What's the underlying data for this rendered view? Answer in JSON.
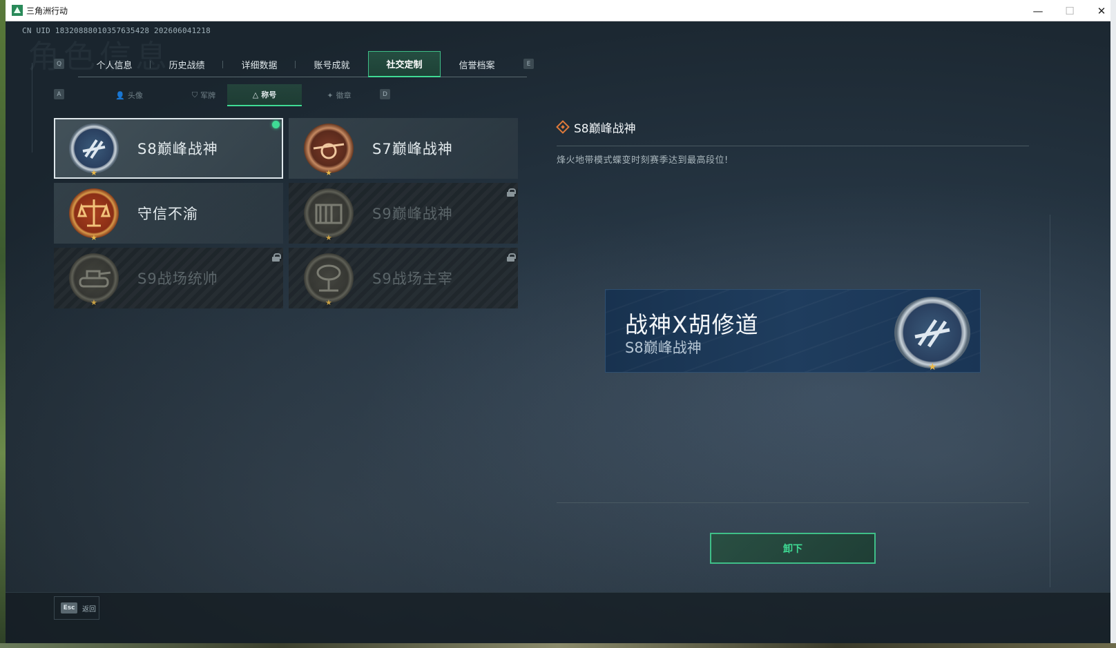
{
  "window": {
    "title": "三角洲行动",
    "minimize": "—",
    "maximize": "☐",
    "close": "✕"
  },
  "uid": "CN UID 18320888010357635428 202606041218",
  "ghost_title": "角色信息",
  "keyhints": {
    "prev_tab": "Q",
    "next_tab": "E",
    "prev_sub": "A",
    "next_sub": "D"
  },
  "top_tabs": [
    {
      "label": "个人信息"
    },
    {
      "label": "历史战绩"
    },
    {
      "label": "详细数据"
    },
    {
      "label": "账号成就"
    },
    {
      "label": "社交定制",
      "active": true
    },
    {
      "label": "信誉档案"
    }
  ],
  "sub_tabs": [
    {
      "label": "头像",
      "icon": "person-icon"
    },
    {
      "label": "军牌",
      "icon": "tag-icon"
    },
    {
      "label": "称号",
      "icon": "triangle-icon",
      "active": true
    },
    {
      "label": "徽章",
      "icon": "badge-icon"
    }
  ],
  "titles": [
    {
      "label": "S8巅峰战神",
      "medal": "wings-medal",
      "selected": true,
      "equipped": true,
      "locked": false
    },
    {
      "label": "S7巅峰战神",
      "medal": "rifle-medal",
      "selected": false,
      "equipped": false,
      "locked": false
    },
    {
      "label": "守信不渝",
      "medal": "scale-medal",
      "selected": false,
      "equipped": false,
      "locked": false
    },
    {
      "label": "S9巅峰战神",
      "medal": "fortress-medal",
      "selected": false,
      "equipped": false,
      "locked": true
    },
    {
      "label": "S9战场统帅",
      "medal": "tank-medal",
      "selected": false,
      "equipped": false,
      "locked": true
    },
    {
      "label": "S9战场主宰",
      "medal": "mushroom-cloud-medal",
      "selected": false,
      "equipped": false,
      "locked": true
    }
  ],
  "detail": {
    "title": "S8巅峰战神",
    "description": "烽火地带模式蝶变时刻赛季达到最高段位!"
  },
  "banner": {
    "player_name": "战神X胡修道",
    "title": "S8巅峰战神"
  },
  "unequip_label": "卸下",
  "footer": {
    "esc_key": "Esc",
    "back_label": "返回"
  },
  "colors": {
    "accent": "#3fdc95",
    "active_tab_bg": "#285a46",
    "banner_bg": "#1f3d5e",
    "detail_icon": "#e07a3a"
  }
}
